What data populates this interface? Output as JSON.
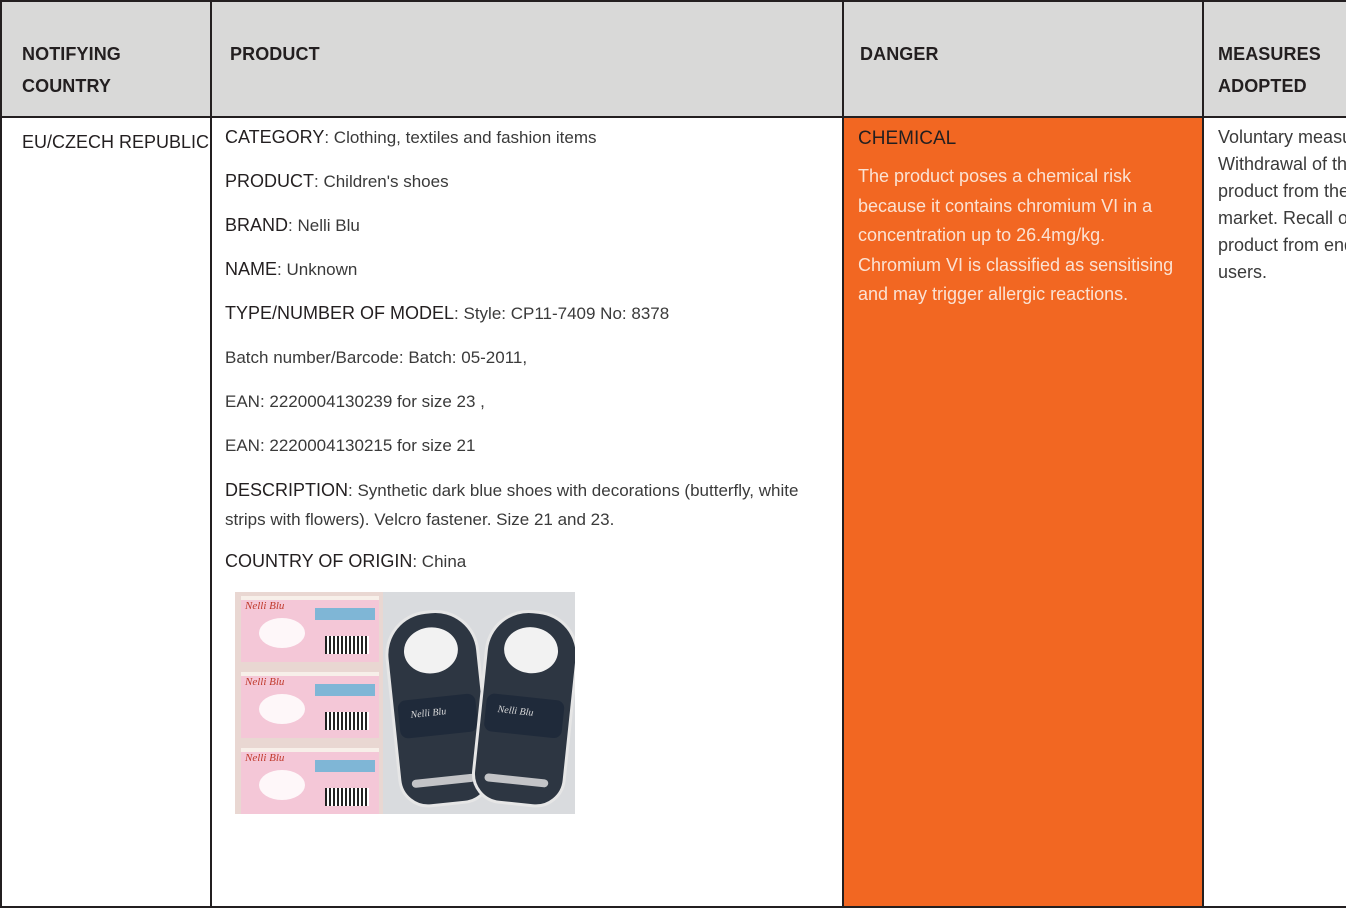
{
  "header": {
    "col1": "NOTIFYING COUNTRY",
    "col2": "PRODUCT",
    "col3": "DANGER",
    "col4": "MEASURES ADOPTED"
  },
  "row": {
    "country": "EU/CZECH REPUBLIC",
    "product": {
      "category_label": "CATEGORY",
      "category_value": ": Clothing, textiles and fashion items",
      "product_label": "PRODUCT",
      "product_value": ": Children's shoes",
      "brand_label": "BRAND",
      "brand_value": ": Nelli Blu",
      "name_label": "NAME",
      "name_value": ": Unknown",
      "model_label": "TYPE/NUMBER OF MODEL",
      "model_value": ": Style: CP11-7409 No: 8378",
      "batch_line": "Batch number/Barcode: Batch: 05-2011,",
      "ean_line1": "EAN: 2220004130239 for size 23 ,",
      "ean_line2": "EAN: 2220004130215 for size 21",
      "description_label": "DESCRIPTION",
      "description_value": ": Synthetic dark blue shoes with decorations (butterfly, white strips with flowers). Velcro fastener. Size 21 and 23.",
      "origin_label": "COUNTRY OF ORIGIN",
      "origin_value": ": China",
      "image_brand_text": "Nelli Blu"
    },
    "danger": {
      "title": "CHEMICAL",
      "text": "The product poses a chemical risk because it contains chromium VI in a concentration up to 26.4mg/kg. Chromium VI is classified as sensitising and may trigger allergic reactions."
    },
    "measures": "Voluntary measures: Withdrawal of the product from the market. Recall of the product from end users."
  },
  "colors": {
    "header_bg": "#d9d9d8",
    "danger_bg": "#f26722",
    "border": "#231f20"
  }
}
